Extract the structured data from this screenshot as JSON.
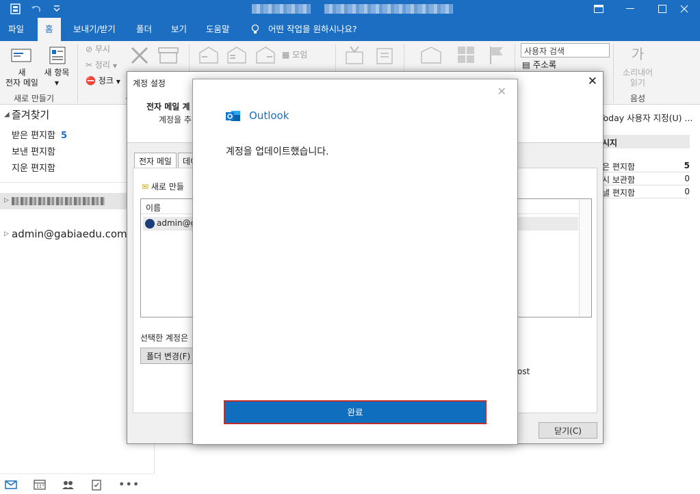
{
  "titlebar": {
    "accent": "#1b6ec2",
    "icons": [
      "app-icon",
      "undo-icon",
      "customize-icon"
    ],
    "window_buttons": [
      "ribbon-display-icon",
      "minimize-icon",
      "maximize-icon",
      "close-icon"
    ]
  },
  "menu": {
    "tabs": [
      "파일",
      "홈",
      "보내기/받기",
      "폴더",
      "보기",
      "도움말"
    ],
    "tell_me": "어떤 작업을 원하시나요?"
  },
  "ribbon": {
    "new_email_line1": "새",
    "new_email_line2": "전자 메일",
    "new_items_line1": "새 항목",
    "new_group_label": "새로 만들기",
    "ignore": "무시",
    "cleanup": "정리",
    "junk": "정크",
    "delete_group_label": "삭",
    "meeting": "모임",
    "search_people": "사용자 검색",
    "address_book": "주소록",
    "speech_line1": "소리내어",
    "speech_line2": "읽기",
    "speech_group_label": "음성",
    "speech_icon_text": "가"
  },
  "nav": {
    "favorites": "즐겨찾기",
    "inbox": "받은 편지함",
    "inbox_count": "5",
    "sent": "보낸 편지함",
    "deleted": "지운 편지함",
    "account2": "admin@gabiaedu.com"
  },
  "right_pane": {
    "today_label": "Today 사용자 지정(U) ...",
    "messages_header": "시지",
    "rows": [
      {
        "label": "은 편지함",
        "value": "5"
      },
      {
        "label": "시 보관함",
        "value": "0"
      },
      {
        "label": "낼 편지함",
        "value": "0"
      }
    ]
  },
  "account_dialog": {
    "title": "계정 설정",
    "heading": "전자 메일 계",
    "subheading": "계정을 추",
    "tab_email": "전자 메일",
    "tab_data": "데이",
    "new_button": "새로 만들",
    "list_header": "이름",
    "list_row": "admin@g",
    "selected_text": "선택한 계정은",
    "change_folder": "폴더 변경(F)",
    "bg_text": "ost",
    "close_button": "닫기(C)"
  },
  "modal": {
    "brand": "Outlook",
    "brand_icon": "outlook-logo-icon",
    "message": "계정을 업데이트했습니다.",
    "done_button": "완료",
    "button_color": "#106ebe",
    "highlight_border": "#c42b2b"
  }
}
